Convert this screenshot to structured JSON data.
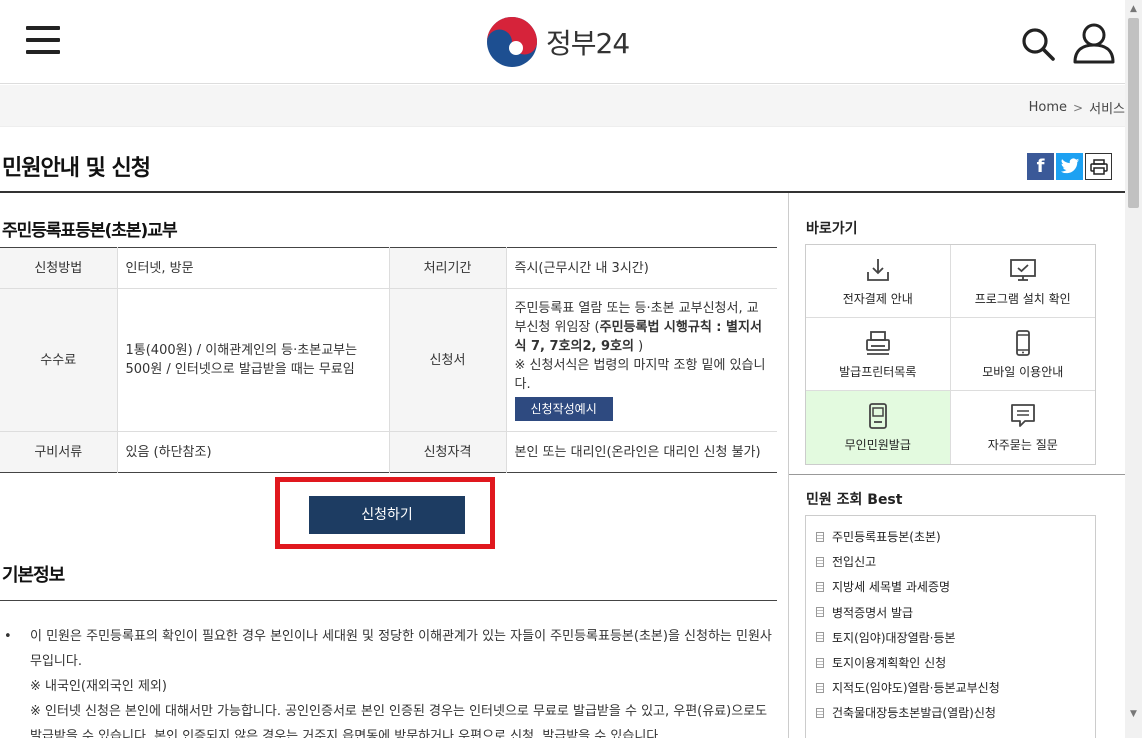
{
  "header": {
    "logo_text": "정부24",
    "brand_colors": {
      "red": "#d6233a",
      "blue": "#1d4f91"
    }
  },
  "breadcrumb": {
    "home": "Home",
    "current": "서비스"
  },
  "page": {
    "title": "민원안내 및 신청"
  },
  "service": {
    "title": "주민등록표등본(초본)교부",
    "rows": [
      {
        "label1": "신청방법",
        "value1": "인터넷, 방문",
        "label2": "처리기간",
        "value2": "즉시(근무시간 내 3시간)"
      },
      {
        "label1": "수수료",
        "value1": "1통(400원) / 이해관계인의 등·초본교부는 500원 / 인터넷으로 발급받을 때는 무료임",
        "label2": "신청서",
        "value2_text": "주민등록표 열람 또는 등·초본 교부신청서, 교부신청 위임장 (",
        "value2_bold": "주민등록법 시행규칙 : 별지서식 7, 7호의2, 9호의",
        "value2_close": " )",
        "value2_note": "※ 신청서식은 법령의 마지막 조항 밑에 있습니다.",
        "sample_button": "신청작성예시"
      },
      {
        "label1": "구비서류",
        "value1": "있음 (하단참조)",
        "label2": "신청자격",
        "value2": "본인 또는 대리인(온라인은 대리인 신청 불가)"
      }
    ],
    "apply_button": "신청하기",
    "highlight_color": "#e0181e"
  },
  "basic_info": {
    "title": "기본정보",
    "bullet": "•",
    "lines": [
      "이 민원은 주민등록표의 확인이 필요한 경우 본인이나 세대원 및 정당한 이해관계가 있는 자들이 주민등록표등본(초본)을 신청하는 민원사무입니다.",
      "※ 내국인(재외국인 제외)",
      "※ 인터넷 신청은 본인에 대해서만 가능합니다. 공인인증서로 본인 인증된 경우는 인터넷으로 무료로 발급받을 수 있고, 우편(유료)으로도 발급받을 수 있습니다. 본인 인증되지 않은 경우는 거주지 읍면동에 방문하거나 우편으로 신청, 발급받을 수 있습니다."
    ]
  },
  "sidebar": {
    "shortcut_title": "바로가기",
    "shortcuts": [
      {
        "label": "전자결제 안내",
        "icon": "download-tray-icon"
      },
      {
        "label": "프로그램 설치 확인",
        "icon": "monitor-check-icon"
      },
      {
        "label": "발급프린터목록",
        "icon": "printer-icon"
      },
      {
        "label": "모바일 이용안내",
        "icon": "mobile-phone-icon"
      },
      {
        "label": "무인민원발급",
        "icon": "kiosk-icon"
      },
      {
        "label": "자주묻는 질문",
        "icon": "speech-bubble-icon"
      }
    ],
    "best_title": "민원 조회 Best",
    "best_items": [
      "주민등록표등본(초본)",
      "전입신고",
      "지방세 세목별 과세증명",
      "병적증명서 발급",
      "토지(임야)대장열람·등본",
      "토지이용계획확인 신청",
      "지적도(임야도)열람·등본교부신청",
      "건축물대장등초본발급(열람)신청"
    ]
  }
}
